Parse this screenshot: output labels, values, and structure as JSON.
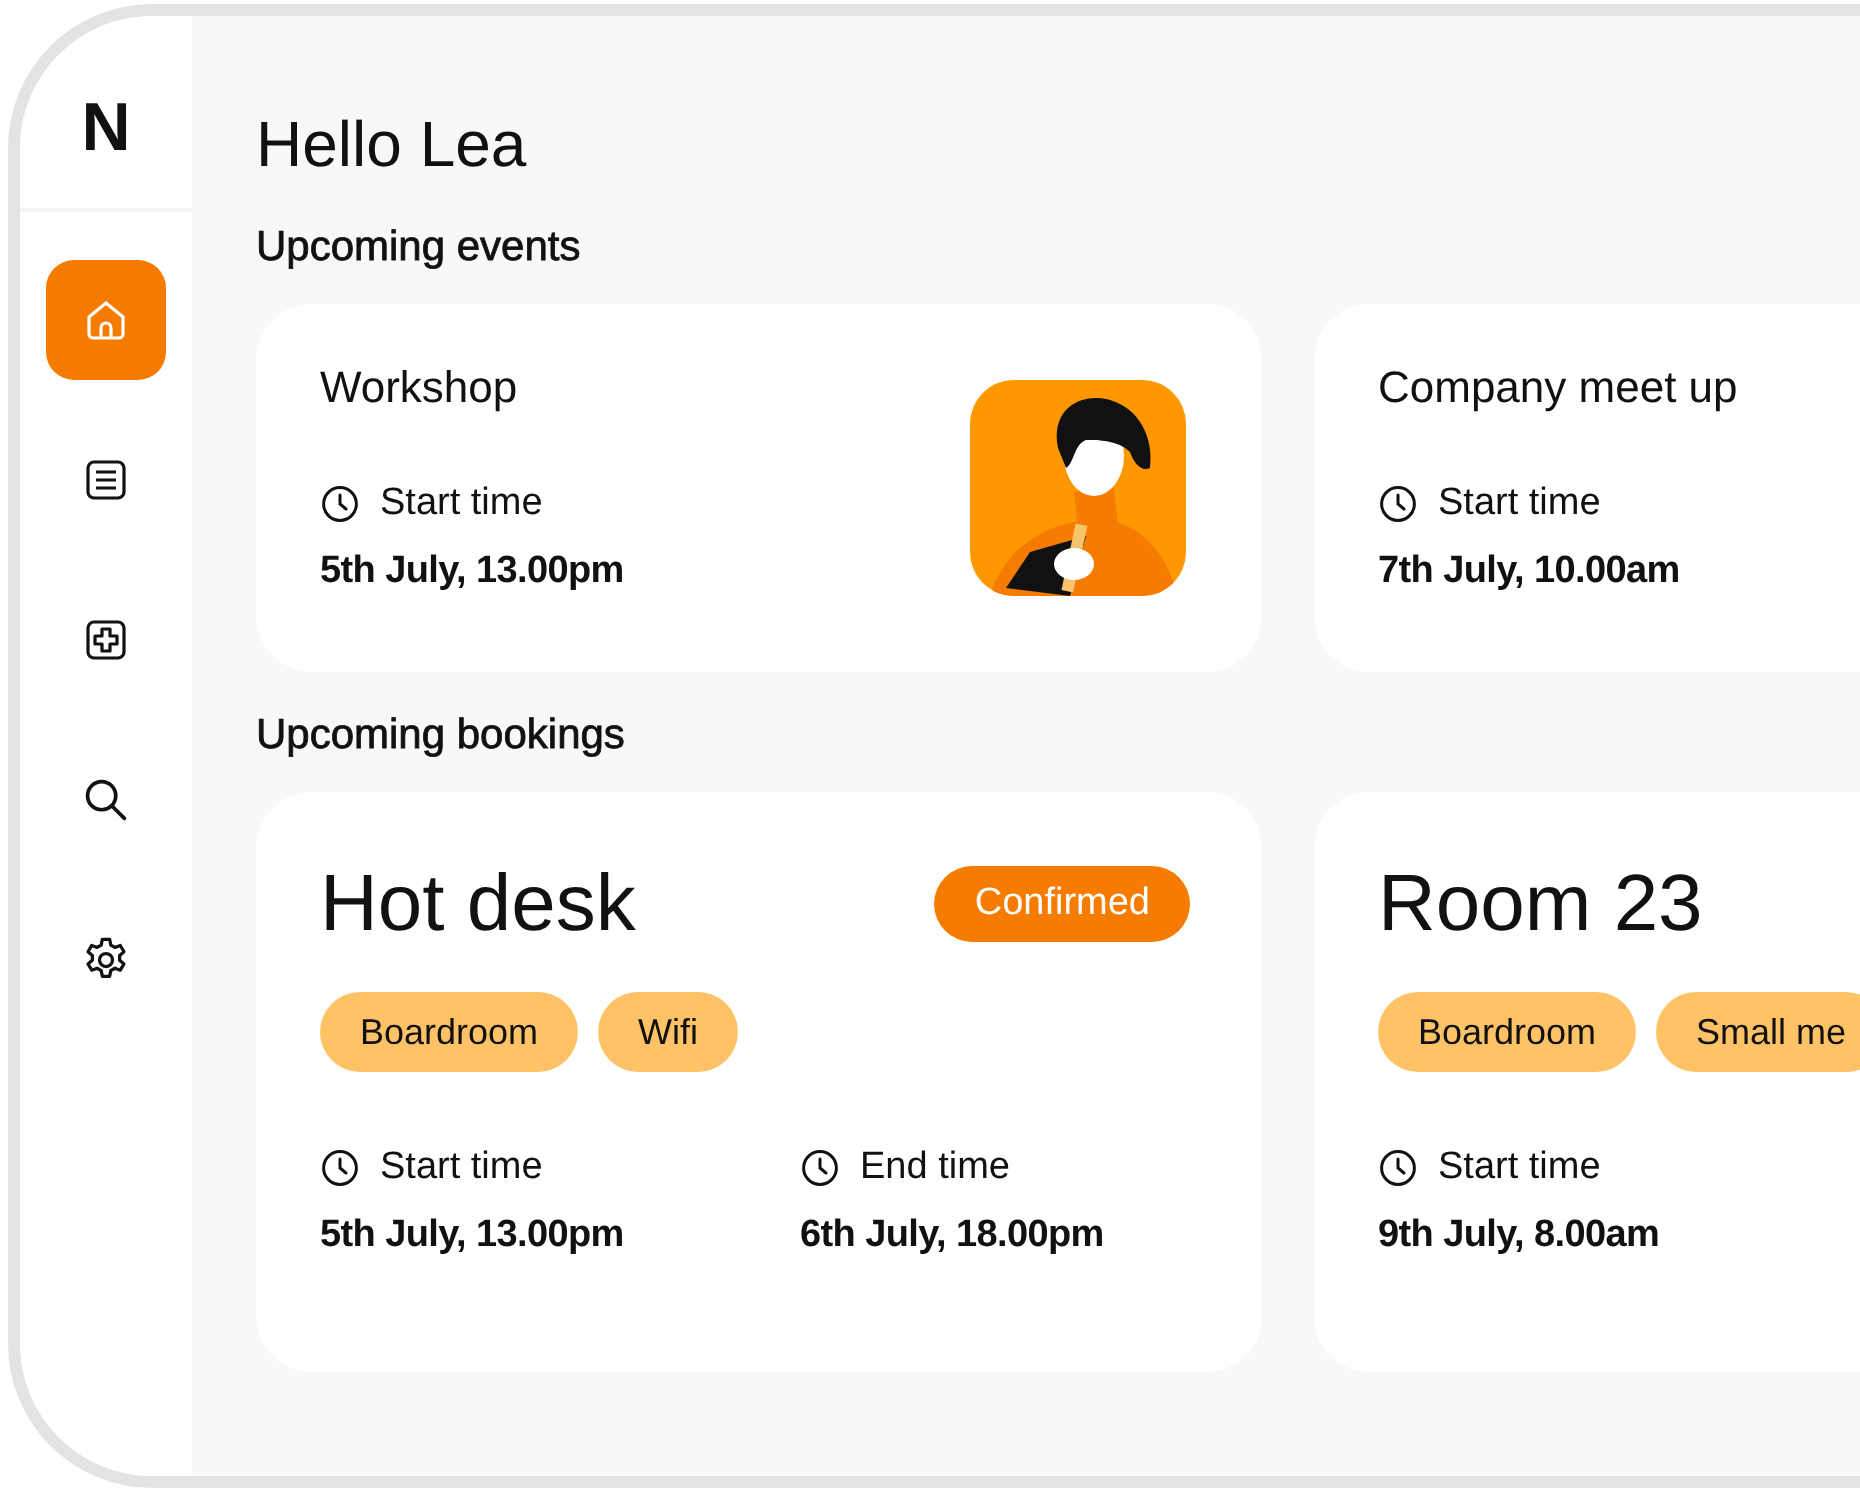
{
  "sidebar": {
    "logo": "N",
    "items": [
      {
        "kind": "home",
        "selected": true
      },
      {
        "kind": "list",
        "selected": false
      },
      {
        "kind": "add",
        "selected": false
      },
      {
        "kind": "search",
        "selected": false
      },
      {
        "kind": "settings",
        "selected": false
      }
    ]
  },
  "greeting": "Hello Lea",
  "events": {
    "heading": "Upcoming events",
    "cards": [
      {
        "title": "Workshop",
        "time_label": "Start time",
        "time_value": "5th July, 13.00pm"
      },
      {
        "title": "Company meet up",
        "time_label": "Start time",
        "time_value": "7th July, 10.00am"
      }
    ]
  },
  "bookings": {
    "heading": "Upcoming bookings",
    "cards": [
      {
        "title": "Hot desk",
        "status": "Confirmed",
        "tags": [
          "Boardroom",
          "Wifi"
        ],
        "times": [
          {
            "label": "Start time",
            "value": "5th July, 13.00pm"
          },
          {
            "label": "End time",
            "value": "6th July, 18.00pm"
          }
        ]
      },
      {
        "title": "Room 23",
        "tags": [
          "Boardroom",
          "Small me"
        ],
        "times": [
          {
            "label": "Start time",
            "value": "9th July, 8.00am"
          }
        ]
      }
    ]
  }
}
